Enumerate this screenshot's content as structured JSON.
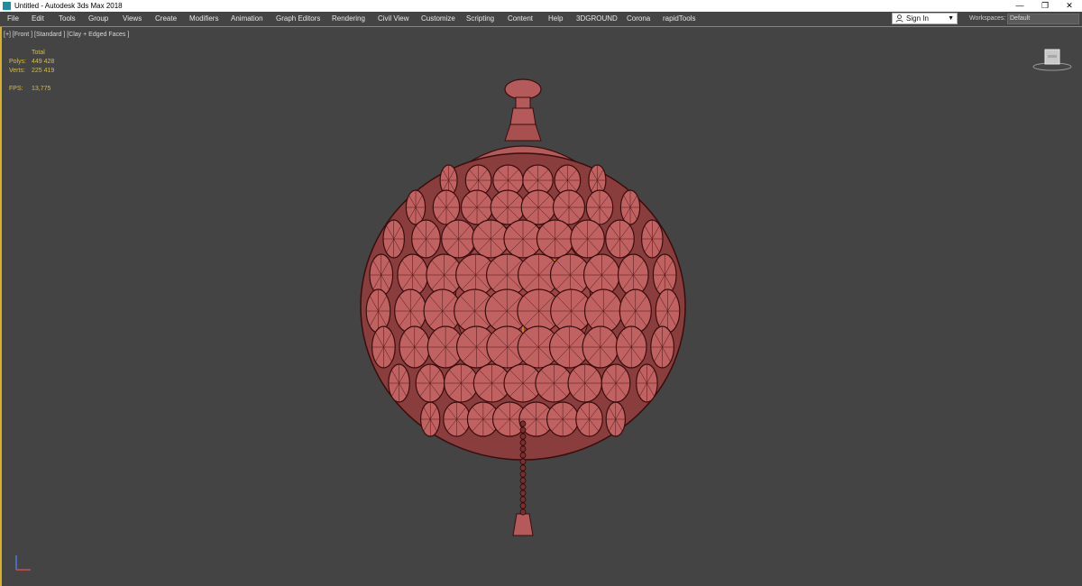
{
  "window": {
    "title": "Untitled - Autodesk 3ds Max 2018",
    "minimize_glyph": "—",
    "restore_glyph": "❐",
    "close_glyph": "✕"
  },
  "menu": {
    "items": [
      "File",
      "Edit",
      "Tools",
      "Group",
      "Views",
      "Create",
      "Modifiers",
      "Animation",
      "Graph Editors",
      "Rendering",
      "Civil View",
      "Customize",
      "Scripting",
      "Content",
      "Help",
      "3DGROUND",
      "Corona",
      "rapidTools"
    ]
  },
  "account": {
    "sign_in_label": "Sign In"
  },
  "workspaces": {
    "label": "Workspaces:",
    "value": "Default"
  },
  "viewport": {
    "label": "[+] [Front ] [Standard ] [Clay + Edged Faces ]",
    "stats": {
      "total_header": "Total",
      "polys_label": "Polys:",
      "polys_value": "449 428",
      "verts_label": "Verts:",
      "verts_value": "225 419",
      "fps_label": "FPS:",
      "fps_value": "13,775"
    }
  },
  "colors": {
    "accent": "#d6b22a",
    "stats_text": "#e3c300",
    "viewport_bg": "#444444",
    "model_fill": "#b45a5a",
    "model_wire": "#3a0d0d"
  },
  "icons": {
    "app": "3dsmax-app-icon",
    "user": "user-icon",
    "viewcube": "viewcube-icon",
    "axis": "axis-gizmo-icon"
  }
}
